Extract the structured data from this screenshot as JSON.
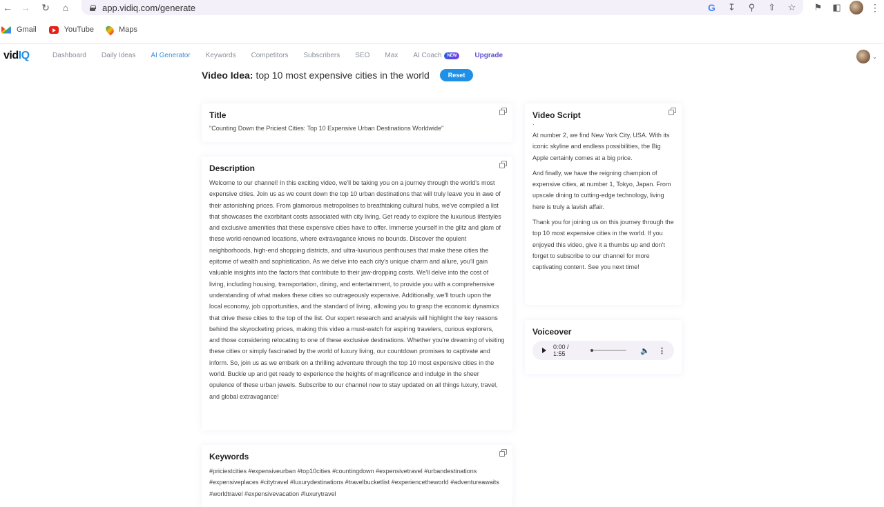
{
  "browser": {
    "url": "app.vidiq.com/generate",
    "bookmarks": [
      {
        "label": "Gmail",
        "icon": "gmail-icon"
      },
      {
        "label": "YouTube",
        "icon": "youtube-icon"
      },
      {
        "label": "Maps",
        "icon": "maps-icon"
      }
    ]
  },
  "app": {
    "logo_main": "vid",
    "logo_accent": "IQ",
    "nav": [
      {
        "label": "Dashboard"
      },
      {
        "label": "Daily Ideas"
      },
      {
        "label": "AI Generator",
        "active": true
      },
      {
        "label": "Keywords"
      },
      {
        "label": "Competitors"
      },
      {
        "label": "Subscribers"
      },
      {
        "label": "SEO"
      },
      {
        "label": "Max"
      },
      {
        "label": "AI Coach",
        "badge": "NEW"
      },
      {
        "label": "Upgrade"
      }
    ],
    "colors": {
      "accent": "#1e90e8",
      "upgrade": "#5b4fcf",
      "active_nav": "#3e8fd8"
    }
  },
  "idea": {
    "label": "Video Idea:",
    "value": "top 10 most expensive cities in the world",
    "reset_label": "Reset"
  },
  "cards": {
    "title": {
      "heading": "Title",
      "body": "\"Counting Down the Priciest Cities: Top 10 Expensive Urban Destinations Worldwide\""
    },
    "description": {
      "heading": "Description",
      "body": "Welcome to our channel! In this exciting video, we'll be taking you on a journey through the world's most expensive cities. Join us as we count down the top 10 urban destinations that will truly leave you in awe of their astonishing prices. From glamorous metropolises to breathtaking cultural hubs, we've compiled a list that showcases the exorbitant costs associated with city living. Get ready to explore the luxurious lifestyles and exclusive amenities that these expensive cities have to offer. Immerse yourself in the glitz and glam of these world-renowned locations, where extravagance knows no bounds. Discover the opulent neighborhoods, high-end shopping districts, and ultra-luxurious penthouses that make these cities the epitome of wealth and sophistication. As we delve into each city's unique charm and allure, you'll gain valuable insights into the factors that contribute to their jaw-dropping costs. We'll delve into the cost of living, including housing, transportation, dining, and entertainment, to provide you with a comprehensive understanding of what makes these cities so outrageously expensive. Additionally, we'll touch upon the local economy, job opportunities, and the standard of living, allowing you to grasp the economic dynamics that drive these cities to the top of the list. Our expert research and analysis will highlight the key reasons behind the skyrocketing prices, making this video a must-watch for aspiring travelers, curious explorers, and those considering relocating to one of these exclusive destinations. Whether you're dreaming of visiting these cities or simply fascinated by the world of luxury living, our countdown promises to captivate and inform. So, join us as we embark on a thrilling adventure through the top 10 most expensive cities in the world. Buckle up and get ready to experience the heights of magnificence and indulge in the sheer opulence of these urban jewels. Subscribe to our channel now to stay updated on all things luxury, travel, and global extravagance!"
    },
    "keywords": {
      "heading": "Keywords",
      "body": "#priciestcities #expensiveurban #top10cities #countingdown #expensivetravel #urbandestinations #expensiveplaces #citytravel #luxurydestinations #travelbucketlist #experiencetheworld #adventureawaits #worldtravel #expensivevacation #luxurytravel"
    },
    "script": {
      "heading": "Video Script",
      "paragraphs": [
        "At number 2, we find New York City, USA. With its iconic skyline and endless possibilities, the Big Apple certainly comes at a big price.",
        "And finally, we have the reigning champion of expensive cities, at number 1, Tokyo, Japan. From upscale dining to cutting-edge technology, living here is truly a lavish affair.",
        "Thank you for joining us on this journey through the top 10 most expensive cities in the world. If you enjoyed this video, give it a thumbs up and don't forget to subscribe to our channel for more captivating content. See you next time!"
      ]
    },
    "voiceover": {
      "heading": "Voiceover",
      "time": "0:00 / 1:55",
      "progress": 0
    }
  }
}
